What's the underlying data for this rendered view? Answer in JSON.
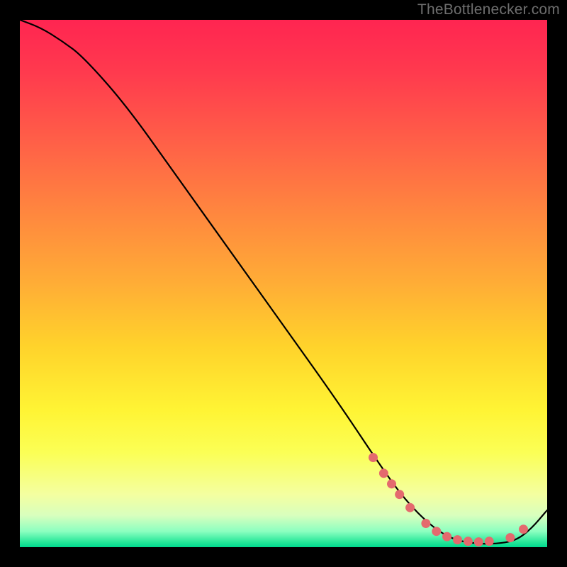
{
  "credit": "TheBottlenecker.com",
  "colors": {
    "dot": "#e46a6e",
    "curve": "#000000"
  },
  "chart_data": {
    "type": "line",
    "title": "",
    "xlabel": "",
    "ylabel": "",
    "xlim": [
      0,
      100
    ],
    "ylim": [
      0,
      100
    ],
    "grid": false,
    "series": [
      {
        "name": "bottleneck-curve",
        "x": [
          0,
          4,
          8,
          12,
          20,
          30,
          40,
          50,
          60,
          68,
          73,
          78,
          82,
          86,
          90,
          94,
          97,
          100
        ],
        "y": [
          100,
          98.5,
          96,
          93,
          84,
          70,
          56,
          42,
          28,
          16,
          9,
          4,
          1.5,
          0.7,
          0.6,
          1.2,
          3.5,
          7
        ]
      }
    ],
    "marker_points": {
      "name": "highlight-dots",
      "x": [
        67,
        69,
        70.5,
        72,
        74,
        77,
        79,
        81,
        83,
        85,
        87,
        89,
        93,
        95.5
      ],
      "y": [
        17,
        14,
        12,
        10,
        7.5,
        4.5,
        3,
        2,
        1.4,
        1.1,
        1.0,
        1.1,
        1.8,
        3.4
      ]
    }
  }
}
